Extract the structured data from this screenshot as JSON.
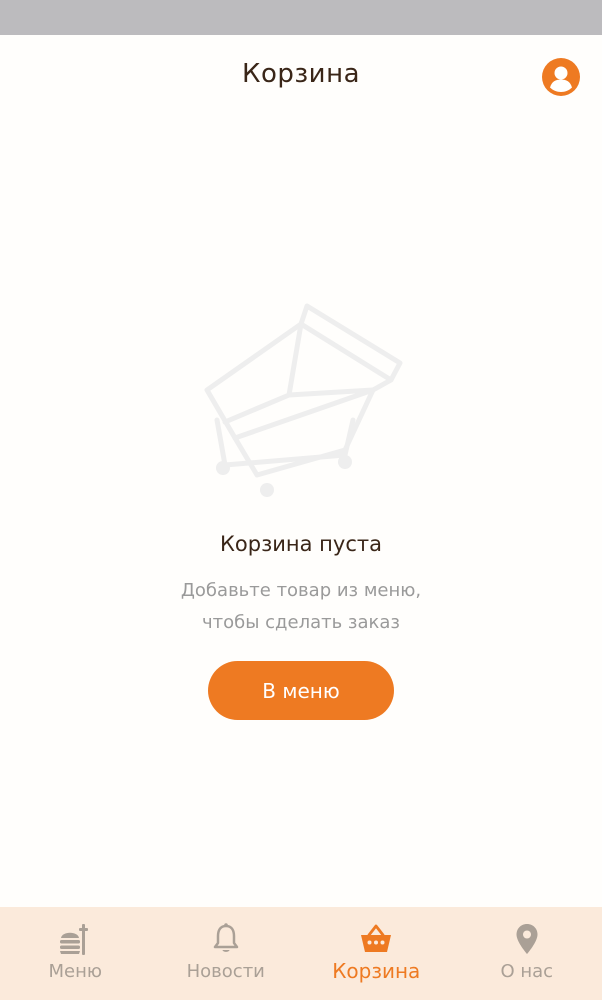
{
  "header": {
    "title": "Корзина",
    "profile_icon": "user-circle-icon"
  },
  "empty_state": {
    "illustration_icon": "shopping-cart-icon",
    "title": "Корзина пуста",
    "subtitle_line1": "Добавьте товар из меню,",
    "subtitle_line2": "чтобы сделать заказ",
    "button_label": "В меню"
  },
  "bottom_nav": {
    "items": [
      {
        "label": "Меню",
        "icon": "food-icon",
        "active": false
      },
      {
        "label": "Новости",
        "icon": "bell-icon",
        "active": false
      },
      {
        "label": "Корзина",
        "icon": "basket-icon",
        "active": true
      },
      {
        "label": "О нас",
        "icon": "location-pin-icon",
        "active": false
      }
    ]
  },
  "colors": {
    "accent": "#ee7a22",
    "nav_background": "#fbeadb",
    "nav_inactive": "#aaa096",
    "status_bar": "#bcbbbe",
    "text_dark": "#3a2618",
    "text_muted": "#9a9a9a"
  }
}
